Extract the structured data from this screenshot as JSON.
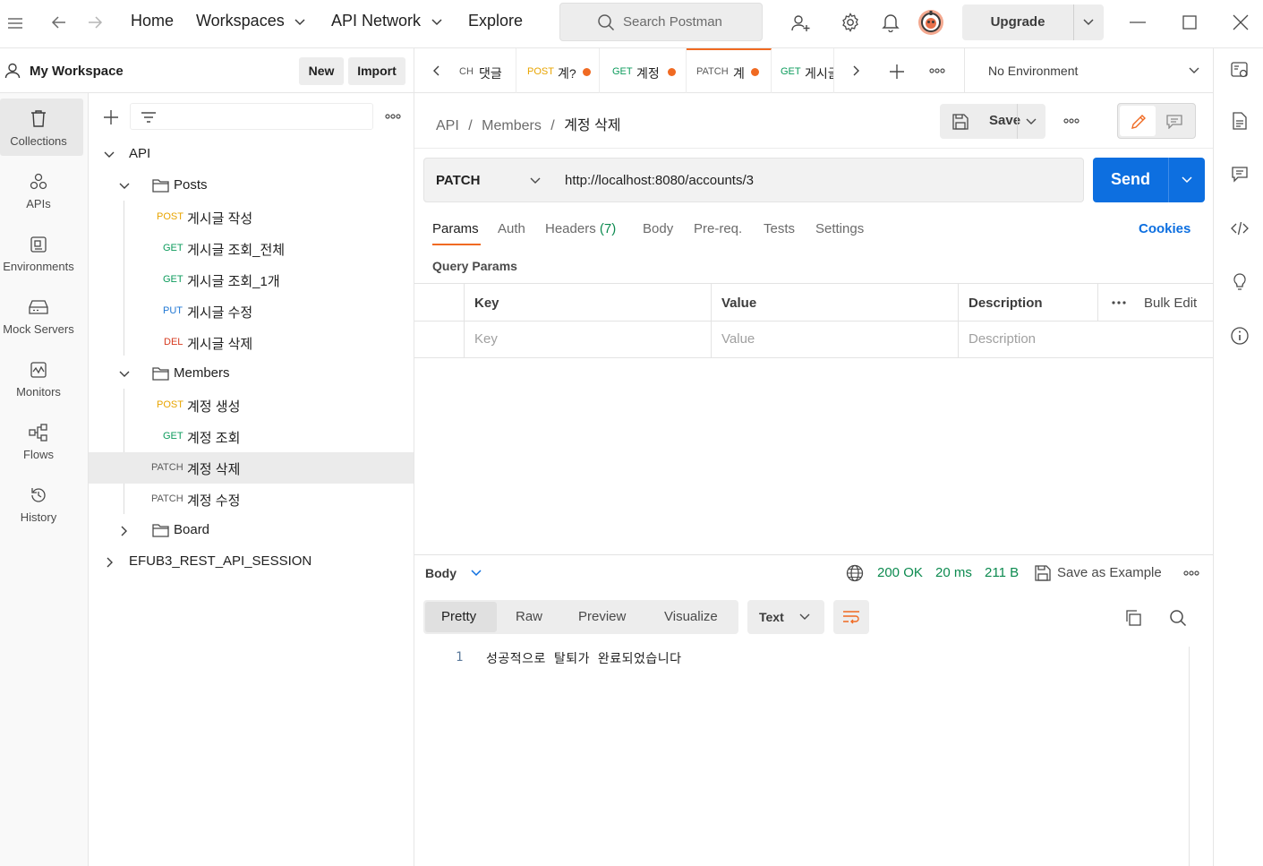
{
  "topbar": {
    "home": "Home",
    "workspaces": "Workspaces",
    "api_network": "API Network",
    "explore": "Explore",
    "search_placeholder": "Search Postman",
    "upgrade": "Upgrade"
  },
  "workspace": {
    "title": "My Workspace",
    "new_label": "New",
    "import_label": "Import"
  },
  "rail": [
    {
      "label": "Collections",
      "icon": "trash-can-icon"
    },
    {
      "label": "APIs",
      "icon": "apis-icon"
    },
    {
      "label": "Environments",
      "icon": "environment-icon"
    },
    {
      "label": "Mock Servers",
      "icon": "server-icon"
    },
    {
      "label": "Monitors",
      "icon": "monitor-icon"
    },
    {
      "label": "Flows",
      "icon": "flows-icon"
    },
    {
      "label": "History",
      "icon": "history-icon"
    }
  ],
  "tree": {
    "api": "API",
    "posts": "Posts",
    "posts_items": [
      {
        "method": "POST",
        "name": "게시글 작성"
      },
      {
        "method": "GET",
        "name": "게시글 조회_전체"
      },
      {
        "method": "GET",
        "name": "게시글 조회_1개"
      },
      {
        "method": "PUT",
        "name": "게시글 수정"
      },
      {
        "method": "DEL",
        "name": "게시글 삭제"
      }
    ],
    "members": "Members",
    "members_items": [
      {
        "method": "POST",
        "name": "계정 생성"
      },
      {
        "method": "GET",
        "name": "계정 조회"
      },
      {
        "method": "PATCH",
        "name": "계정 삭제"
      },
      {
        "method": "PATCH",
        "name": "계정 수정"
      }
    ],
    "board": "Board",
    "other_collection": "EFUB3_REST_API_SESSION"
  },
  "tabs": [
    {
      "method": "CH",
      "name": "댓글"
    },
    {
      "method": "POST",
      "name": "계?"
    },
    {
      "method": "GET",
      "name": "계정"
    },
    {
      "method": "PATCH",
      "name": "계"
    },
    {
      "method": "GET",
      "name": "게시글"
    }
  ],
  "environment": "No Environment",
  "breadcrumb": {
    "a": "API",
    "b": "Members",
    "c": "계정 삭제",
    "sep": "/"
  },
  "save_label": "Save",
  "request": {
    "method": "PATCH",
    "url": "http://localhost:8080/accounts/3",
    "send": "Send"
  },
  "req_tabs": {
    "params": "Params",
    "auth": "Auth",
    "headers": "Headers",
    "headers_count": "(7)",
    "body": "Body",
    "prereq": "Pre-req.",
    "tests": "Tests",
    "settings": "Settings",
    "cookies": "Cookies"
  },
  "query_params": {
    "title": "Query Params",
    "key_header": "Key",
    "value_header": "Value",
    "desc_header": "Description",
    "bulk_edit": "Bulk Edit",
    "key_placeholder": "Key",
    "value_placeholder": "Value",
    "desc_placeholder": "Description"
  },
  "response": {
    "body_label": "Body",
    "status": "200 OK",
    "time": "20 ms",
    "size": "211 B",
    "save_example": "Save as Example",
    "views": {
      "pretty": "Pretty",
      "raw": "Raw",
      "preview": "Preview",
      "visualize": "Visualize"
    },
    "format": "Text",
    "line_number": "1",
    "content": "성공적으로 탈퇴가 완료되었습니다"
  },
  "colors": {
    "accent": "#f06a22",
    "send": "#0d6fe0",
    "get": "#0c9b5c",
    "post": "#e8a400",
    "put": "#1f77d4",
    "delete": "#d63a1f"
  }
}
